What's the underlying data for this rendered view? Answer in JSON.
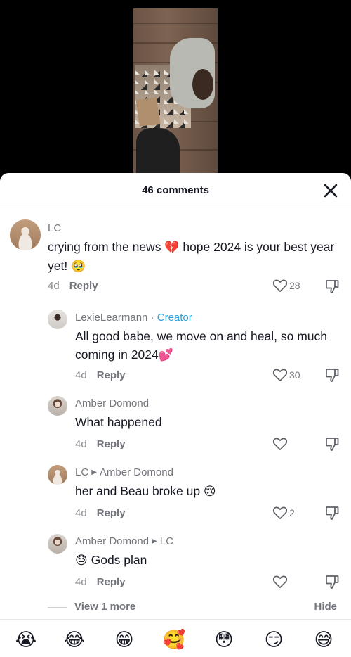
{
  "sheet": {
    "title": "46 comments",
    "close_icon": "close-icon"
  },
  "comments": [
    {
      "author": "LC",
      "text_before": "crying from the news ",
      "emoji1": "💔",
      "text_middle": " hope 2024 is your best year yet! ",
      "emoji2": "🥹",
      "time": "4d",
      "reply_label": "Reply",
      "likes": "28"
    },
    {
      "author": "LexieLearmann",
      "separator": " · ",
      "badge": "Creator",
      "text": "All good babe, we move on and heal, so much coming in 2024",
      "emoji": "💕",
      "time": "4d",
      "reply_label": "Reply",
      "likes": "30"
    },
    {
      "author": "Amber Domond",
      "text": "What happened",
      "time": "4d",
      "reply_label": "Reply",
      "likes": ""
    },
    {
      "author": "LC",
      "reply_to": "Amber Domond",
      "text": "her and Beau broke up ",
      "emoji": "😢",
      "time": "4d",
      "reply_label": "Reply",
      "likes": "2"
    },
    {
      "author": "Amber Domond",
      "reply_to": "LC",
      "emoji": "😓",
      "text": " Gods plan",
      "time": "4d",
      "reply_label": "Reply",
      "likes": ""
    }
  ],
  "footer": {
    "view_more": "View 1 more",
    "hide": "Hide"
  },
  "emoji_bar": [
    "😭",
    "😂",
    "😁",
    "🥰",
    "😳",
    "😏",
    "😅"
  ],
  "colors": {
    "creator": "#2b9fd9",
    "muted": "#73757c",
    "text": "#161823"
  }
}
